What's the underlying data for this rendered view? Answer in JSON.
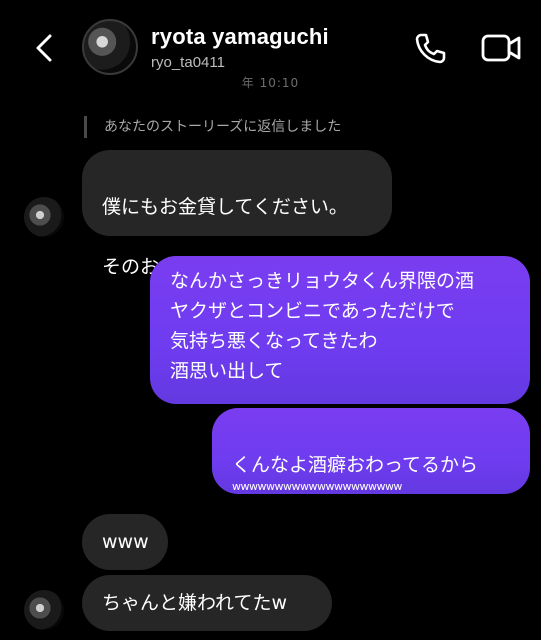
{
  "header": {
    "name": "ryota yamaguchi",
    "handle": "ryo_ta0411",
    "date_fragment": "年 10:10"
  },
  "messages": {
    "reply_note": "あなたのストーリーズに返信しました",
    "m1_line1": "僕にもお金貸してください。",
    "m1_line2": "そのお金で飲み行きます",
    "m2": "なんかさっきリョウタくん界隈の酒\nヤクザとコンビニであっただけで\n気持ち悪くなってきたわ\n酒思い出して",
    "m3_line1": "くんなよ酒癖おわってるから",
    "m3_line2": "wwwwwwwwwwwwwwwwwwww",
    "m4": "www",
    "m5": "ちゃんと嫌われてたw"
  },
  "colors": {
    "background": "#000000",
    "incoming_bubble": "#262626",
    "outgoing_bubble": "#7a3df0"
  },
  "icons": {
    "back": "chevron-left-icon",
    "call": "phone-icon",
    "video": "video-camera-icon",
    "money": "money-bag-icon"
  }
}
